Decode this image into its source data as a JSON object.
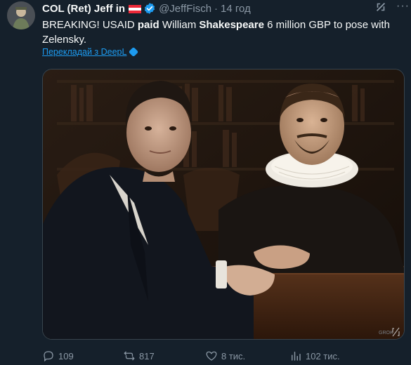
{
  "author": {
    "display_name": "COL (Ret) Jeff in",
    "handle": "@JeffFisch",
    "time": "14 год",
    "flag": "austria-flag",
    "badge": "verified-badge"
  },
  "tweet": {
    "seg1": "BREAKING!  USAID ",
    "seg2": "paid",
    "seg3": " William ",
    "seg4": "Shakespeare",
    "seg5": " 6 million GBP to pose with Zelensky."
  },
  "translate": {
    "label": "Перекладай з DeepL"
  },
  "media": {
    "watermark": "GROK"
  },
  "actions": {
    "replies": "109",
    "reposts": "817",
    "likes": "8 тис.",
    "views": "102 тис."
  },
  "colors": {
    "background": "#15202b",
    "text": "#f7f9f9",
    "muted": "#8b98a5",
    "accent": "#1d9bf0"
  },
  "icons": {
    "reply": "reply-icon",
    "repost": "repost-icon",
    "like": "heart-icon",
    "views": "views-icon",
    "more": "more-icon",
    "grok": "grok-icon"
  }
}
